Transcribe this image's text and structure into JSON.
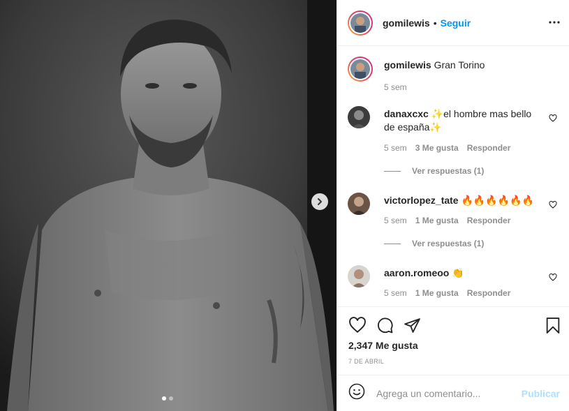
{
  "post": {
    "username": "gomilewis",
    "separator": "•",
    "follow_label": "Seguir",
    "caption": "Gran Torino",
    "caption_time": "5 sem"
  },
  "comments": [
    {
      "username": "danaxcxc",
      "text": "✨el hombre mas bello de españa✨",
      "time": "5 sem",
      "likes": "3 Me gusta",
      "reply_label": "Responder",
      "view_replies": "Ver respuestas (1)"
    },
    {
      "username": "victorlopez_tate",
      "text": "🔥🔥🔥🔥🔥🔥",
      "time": "5 sem",
      "likes": "1 Me gusta",
      "reply_label": "Responder",
      "view_replies": "Ver respuestas (1)"
    },
    {
      "username": "aaron.romeoo",
      "text": "👏",
      "time": "5 sem",
      "likes": "1 Me gusta",
      "reply_label": "Responder"
    }
  ],
  "footer": {
    "likes": "2,347 Me gusta",
    "date": "7 DE ABRIL",
    "comment_placeholder": "Agrega un comentario...",
    "publish_label": "Publicar"
  },
  "carousel": {
    "count": 2,
    "active": 1
  },
  "icons": {
    "more": "more-options-icon",
    "next": "chevron-right-icon",
    "like": "heart-icon",
    "comment": "comment-icon",
    "share": "share-icon",
    "save": "bookmark-icon",
    "emoji": "emoji-icon"
  },
  "colors": {
    "follow": "#0095f6",
    "publish_disabled": "#b2dffc",
    "muted": "#8e8e8e",
    "text": "#262626"
  }
}
